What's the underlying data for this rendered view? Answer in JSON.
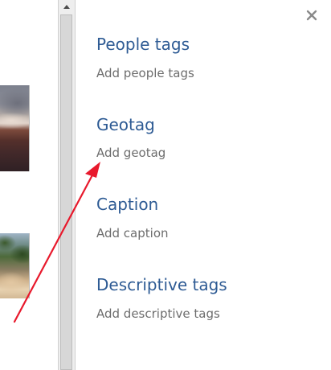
{
  "window": {
    "close_icon": "close-icon"
  },
  "scrollbar": {
    "up_icon": "scroll-up-arrow-icon"
  },
  "details": {
    "sections": [
      {
        "title": "People tags",
        "action": "Add people tags"
      },
      {
        "title": "Geotag",
        "action": "Add geotag"
      },
      {
        "title": "Caption",
        "action": "Add caption"
      },
      {
        "title": "Descriptive tags",
        "action": "Add descriptive tags"
      }
    ]
  },
  "colors": {
    "heading": "#2e5b94",
    "link": "#6d6d6d",
    "annotation_arrow": "#e8192c"
  },
  "annotation": {
    "icon": "red-pointer-arrow",
    "points_to": "Add geotag"
  }
}
